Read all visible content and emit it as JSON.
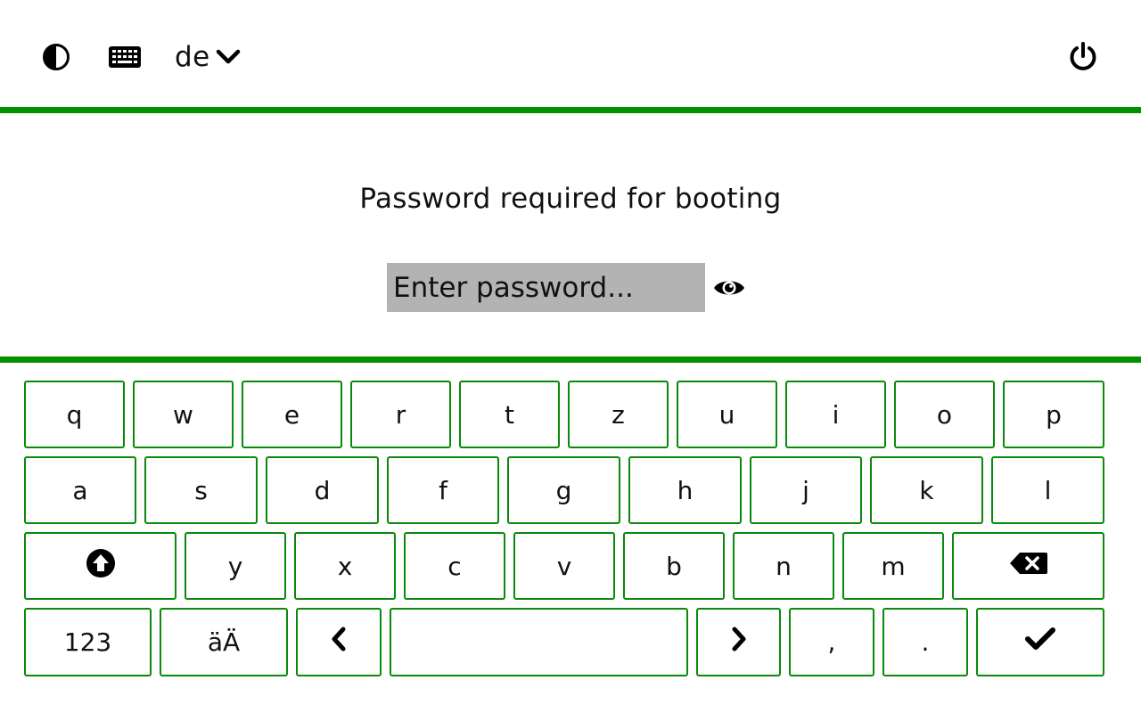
{
  "header": {
    "contrast_icon": "contrast-icon",
    "keyboard_icon": "keyboard-icon",
    "language": "de",
    "language_chevron_icon": "chevron-down-icon",
    "power_icon": "power-icon"
  },
  "colors": {
    "accent": "#009000",
    "key_border": "#0a8a0a",
    "field_bg": "#b3b3b3"
  },
  "main": {
    "prompt": "Password required for booting",
    "password_placeholder": "Enter password...",
    "password_value": "",
    "eye_icon": "eye-icon"
  },
  "keyboard": {
    "row1": [
      "q",
      "w",
      "e",
      "r",
      "t",
      "z",
      "u",
      "i",
      "o",
      "p"
    ],
    "row2": [
      "a",
      "s",
      "d",
      "f",
      "g",
      "h",
      "j",
      "k",
      "l"
    ],
    "row3": [
      "y",
      "x",
      "c",
      "v",
      "b",
      "n",
      "m"
    ],
    "shift_icon": "shift-icon",
    "backspace_icon": "backspace-icon",
    "numbers_label": "123",
    "umlaut_label": "äÄ",
    "left_icon": "chevron-left-icon",
    "space_label": "",
    "right_icon": "chevron-right-icon",
    "comma_label": ",",
    "period_label": ".",
    "enter_icon": "checkmark-icon"
  }
}
